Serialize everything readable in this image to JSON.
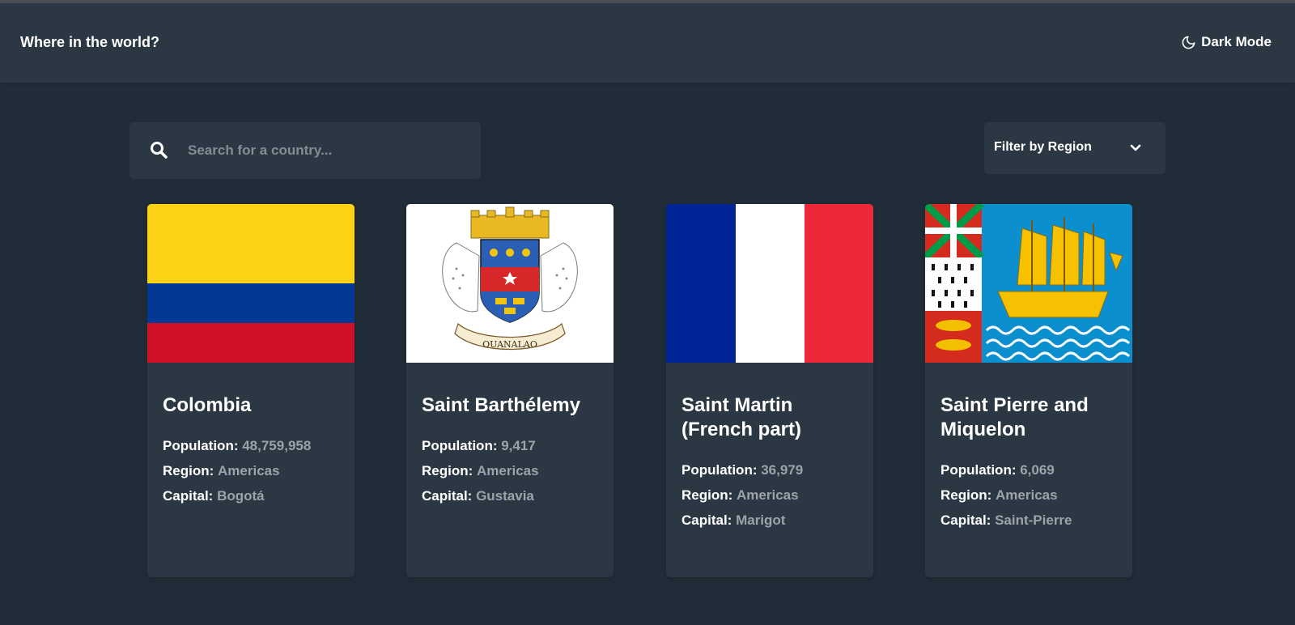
{
  "header": {
    "title": "Where in the world?",
    "theme_toggle": "Dark Mode"
  },
  "search": {
    "placeholder": "Search for a country..."
  },
  "filter": {
    "label": "Filter by Region"
  },
  "labels": {
    "population": "Population:",
    "region": "Region:",
    "capital": "Capital:"
  },
  "countries": [
    {
      "name": "Colombia",
      "population": "48,759,958",
      "region": "Americas",
      "capital": "Bogotá"
    },
    {
      "name": "Saint Barthélemy",
      "population": "9,417",
      "region": "Americas",
      "capital": "Gustavia",
      "motto": "OUANALAO"
    },
    {
      "name": "Saint Martin (French part)",
      "population": "36,979",
      "region": "Americas",
      "capital": "Marigot"
    },
    {
      "name": "Saint Pierre and Miquelon",
      "population": "6,069",
      "region": "Americas",
      "capital": "Saint-Pierre"
    }
  ],
  "colors": {
    "background": "#202c37",
    "element": "#2b3743",
    "text": "#ffffff",
    "muted": "#9ca3a9"
  }
}
